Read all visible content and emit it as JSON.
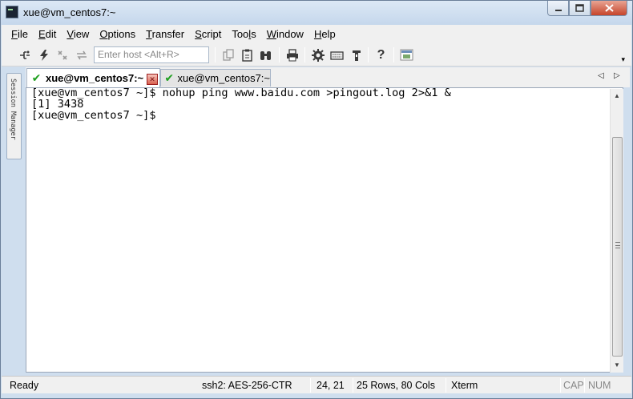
{
  "window": {
    "title": "xue@vm_centos7:~"
  },
  "menu": [
    {
      "underline": "F",
      "rest": "ile"
    },
    {
      "underline": "E",
      "rest": "dit"
    },
    {
      "underline": "V",
      "rest": "iew"
    },
    {
      "underline": "O",
      "rest": "ptions"
    },
    {
      "underline": "T",
      "rest": "ransfer"
    },
    {
      "underline": "S",
      "rest": "cript"
    },
    {
      "pre": "Too",
      "underline": "l",
      "rest": "s"
    },
    {
      "underline": "W",
      "rest": "indow"
    },
    {
      "underline": "H",
      "rest": "elp"
    }
  ],
  "toolbar": {
    "host_placeholder": "Enter host <Alt+R>",
    "icons": [
      "connect-icon",
      "quick-connect-icon",
      "reconnect-icon",
      "disconnect-icon",
      "copy-icon",
      "paste-icon",
      "find-icon",
      "print-icon",
      "session-options-icon",
      "keymap-icon",
      "sftp-icon",
      "help-icon",
      "screen-icon"
    ]
  },
  "side_panel": {
    "label": "Session Manager"
  },
  "tabs": [
    {
      "label": "xue@vm_centos7:~",
      "active": true
    },
    {
      "label": "xue@vm_centos7:~",
      "active": false
    }
  ],
  "terminal": {
    "lines": [
      "[xue@vm_centos7 ~]$ nohup ping www.baidu.com >pingout.log 2>&1 &",
      "[1] 3438",
      "[xue@vm_centos7 ~]$"
    ]
  },
  "status": {
    "state": "Ready",
    "cipher": "ssh2: AES-256-CTR",
    "cursor": "24,  21",
    "size": "25 Rows, 80 Cols",
    "terminal_type": "Xterm",
    "caps": "CAP",
    "num": "NUM"
  }
}
